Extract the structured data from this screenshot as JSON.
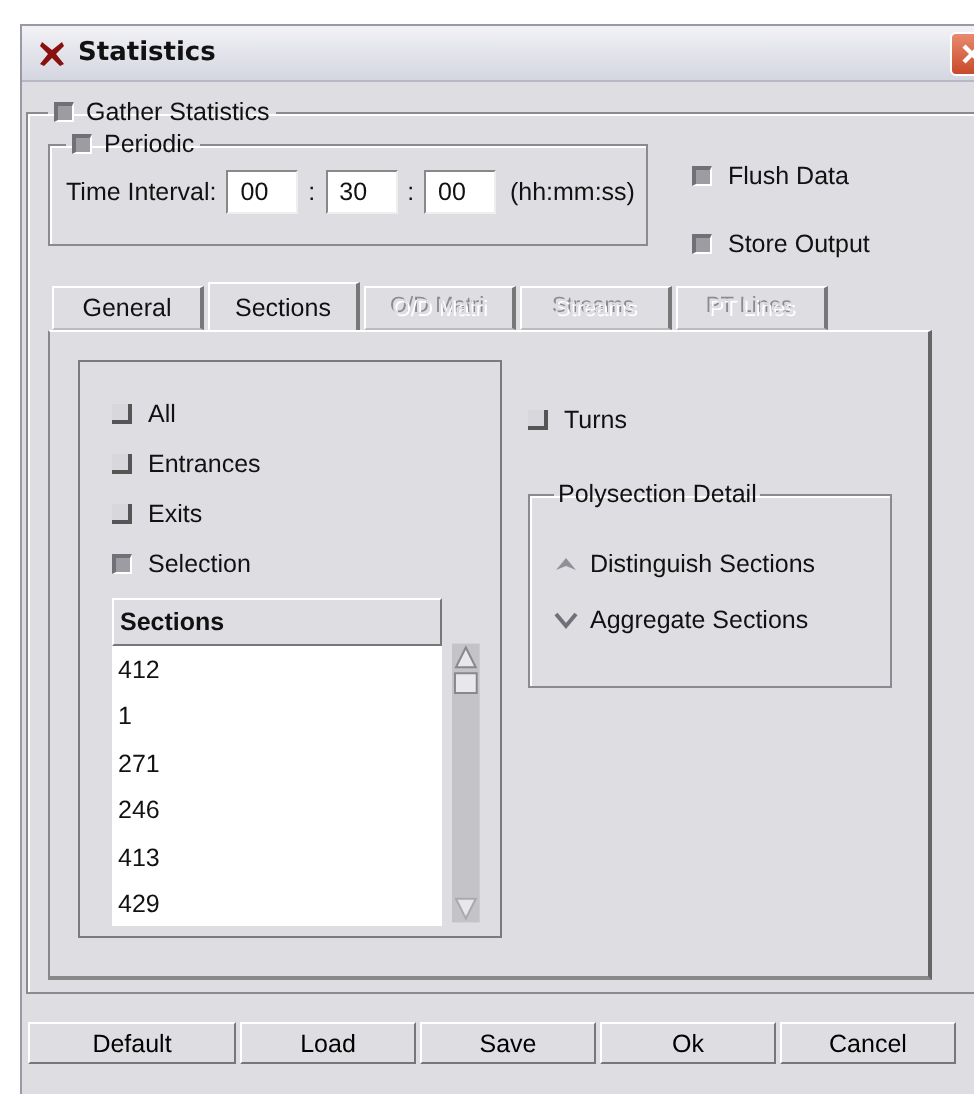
{
  "window": {
    "title": "Statistics"
  },
  "gather": {
    "label": "Gather Statistics",
    "checked": true
  },
  "periodic": {
    "label": "Periodic",
    "checked": true,
    "interval_label": "Time Interval:",
    "fields": [
      {
        "value": "00"
      },
      {
        "value": "30"
      },
      {
        "value": "00"
      }
    ],
    "separator": ":",
    "format": "(hh:mm:ss)"
  },
  "options": [
    {
      "label": "Flush Data",
      "checked": true
    },
    {
      "label": "Store Output",
      "checked": true
    }
  ],
  "tabs": [
    {
      "label": "General",
      "selected": false,
      "disabled": false
    },
    {
      "label": "Sections",
      "selected": true,
      "disabled": false
    },
    {
      "label": "O/D Matri",
      "selected": false,
      "disabled": true
    },
    {
      "label": "Streams",
      "selected": false,
      "disabled": true
    },
    {
      "label": "PT Lines",
      "selected": false,
      "disabled": true
    }
  ],
  "sections": {
    "checks": [
      {
        "label": "All",
        "checked": false
      },
      {
        "label": "Entrances",
        "checked": false
      },
      {
        "label": "Exits",
        "checked": false
      },
      {
        "label": "Selection",
        "checked": true
      }
    ],
    "list": {
      "heading": "Sections",
      "rows": [
        "412",
        "1",
        "271",
        "246",
        "413",
        "429"
      ]
    },
    "turns": {
      "label": "Turns",
      "checked": false
    },
    "polysection": {
      "title": "Polysection Detail",
      "options": [
        {
          "label": "Distinguish Sections",
          "selected": true
        },
        {
          "label": "Aggregate Sections",
          "selected": false
        }
      ]
    }
  },
  "buttons": [
    "Default",
    "Load",
    "Save",
    "Ok",
    "Cancel"
  ]
}
